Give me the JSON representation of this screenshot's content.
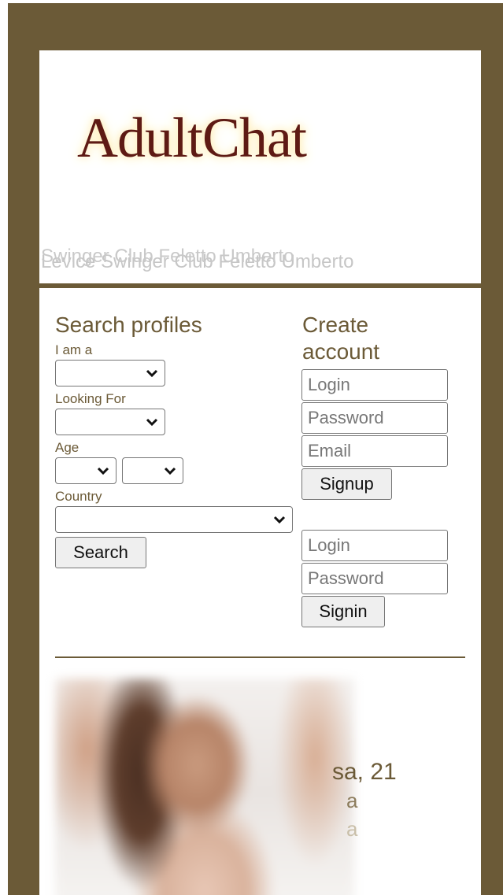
{
  "brand": {
    "logo_text": "AdultChat",
    "tagline_front": "Swinger Club Feletto Umberto",
    "tagline_back": "Levice Swinger Club Feletto Umberto"
  },
  "search": {
    "title": "Search profiles",
    "i_am_label": "I am a",
    "looking_for_label": "Looking For",
    "age_label": "Age",
    "country_label": "Country",
    "button_label": "Search"
  },
  "create_account": {
    "title": "Create account",
    "login_placeholder": "Login",
    "password_placeholder": "Password",
    "email_placeholder": "Email",
    "signup_label": "Signup"
  },
  "signin": {
    "login_placeholder": "Login",
    "password_placeholder": "Password",
    "signin_label": "Signin"
  },
  "profile": {
    "name_age": "sa, 21",
    "line2": "a",
    "line3": "a"
  },
  "colors": {
    "frame": "#6b5a37",
    "logo": "#5e1a14"
  },
  "icons": {
    "select_chevron": "chevron-down-icon"
  }
}
